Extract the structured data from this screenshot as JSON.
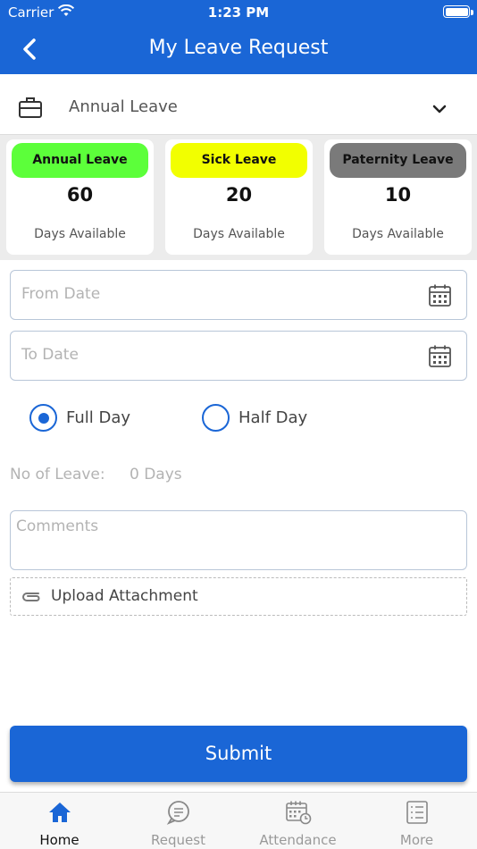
{
  "status_bar": {
    "carrier": "Carrier",
    "time": "1:23 PM"
  },
  "header": {
    "title": "My Leave Request"
  },
  "leave_type": {
    "selected": "Annual Leave"
  },
  "balances": [
    {
      "name": "Annual Leave",
      "days": "60",
      "caption": "Days Available",
      "color": "#5cff3a"
    },
    {
      "name": "Sick Leave",
      "days": "20",
      "caption": "Days Available",
      "color": "#f2ff00"
    },
    {
      "name": "Paternity Leave",
      "days": "10",
      "caption": "Days Available",
      "color": "#7a7a7a"
    }
  ],
  "form": {
    "from_date_placeholder": "From Date",
    "to_date_placeholder": "To Date",
    "duration_options": [
      {
        "label": "Full Day",
        "selected": true
      },
      {
        "label": "Half Day",
        "selected": false
      }
    ],
    "no_of_leave_label": "No of Leave:",
    "no_of_leave_value": "0 Days",
    "comments_placeholder": "Comments",
    "upload_label": "Upload Attachment",
    "submit_label": "Submit"
  },
  "tabs": [
    {
      "label": "Home",
      "icon": "home-icon",
      "active": true
    },
    {
      "label": "Request",
      "icon": "chat-icon",
      "active": false
    },
    {
      "label": "Attendance",
      "icon": "calendar-clock-icon",
      "active": false
    },
    {
      "label": "More",
      "icon": "list-icon",
      "active": false
    }
  ],
  "colors": {
    "primary": "#1a66d6"
  }
}
